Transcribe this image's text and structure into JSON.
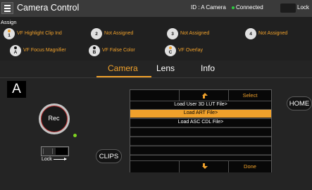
{
  "colors": {
    "accent": "#f0a12b",
    "connected": "#2ecc40",
    "rec_ring": "#b5292b",
    "tally": "#7ed321"
  },
  "header": {
    "title": "Camera Control",
    "camera_id": "ID : A Camera",
    "status": "Connected",
    "lock_label": "Lock"
  },
  "assign": {
    "label": "Assign",
    "row1": [
      {
        "badge": "1",
        "label": "VF Highlight Clip Ind"
      },
      {
        "badge": "2",
        "label": "Not Assigned"
      },
      {
        "badge": "3",
        "label": "Not Assigned"
      },
      {
        "badge": "4",
        "label": "Not Assigned"
      }
    ],
    "row2": [
      {
        "badge": "A",
        "label": "VF Focus Magnifier"
      },
      {
        "badge": "B",
        "label": "VF False Color"
      },
      {
        "badge": "C",
        "label": "VF Overlay"
      }
    ]
  },
  "tabs": [
    {
      "label": "Camera",
      "active": true
    },
    {
      "label": "Lens",
      "active": false
    },
    {
      "label": "Info",
      "active": false
    }
  ],
  "camera_letter": "A",
  "rec_label": "Rec",
  "lock_toggle_label": "Lock",
  "clips_label": "CLIPS",
  "home_label": "HOME",
  "menu": {
    "select_label": "Select",
    "done_label": "Done",
    "items": [
      "Load User 3D LUT File>",
      "Load ART File>",
      "Load ASC CDL File>",
      "",
      "",
      "",
      ""
    ],
    "selected_index": 1
  }
}
